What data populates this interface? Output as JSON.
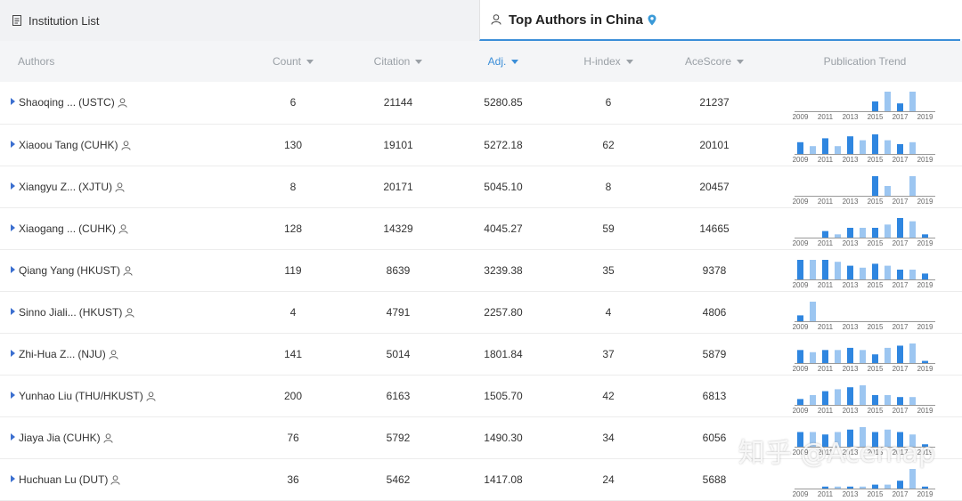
{
  "tabs": {
    "left_label": "Institution List",
    "right_label": "Top Authors in China"
  },
  "columns": {
    "authors": "Authors",
    "count": "Count",
    "citation": "Citation",
    "adj": "Adj.",
    "hindex": "H-index",
    "acescore": "AceScore",
    "trend": "Publication Trend"
  },
  "trend_year_labels": [
    "2009",
    "2011",
    "2013",
    "2015",
    "2017",
    "2019"
  ],
  "colors": {
    "bar_dark": "#2f86e0",
    "bar_light": "#9cc6f1",
    "accent": "#3b8ed8"
  },
  "rows": [
    {
      "name": "Shaoqing ...",
      "aff": "(USTC)",
      "count": "6",
      "citation": "21144",
      "adj": "5280.85",
      "hindex": "6",
      "acescore": "21237",
      "trend": [
        0,
        0,
        0,
        0,
        0,
        0,
        5,
        10,
        4,
        10,
        0
      ]
    },
    {
      "name": "Xiaoou Tang",
      "aff": "(CUHK)",
      "count": "130",
      "citation": "19101",
      "adj": "5272.18",
      "hindex": "62",
      "acescore": "20101",
      "trend": [
        6,
        4,
        8,
        4,
        9,
        7,
        10,
        7,
        5,
        6,
        0
      ]
    },
    {
      "name": "Xiangyu Z...",
      "aff": "(XJTU)",
      "count": "8",
      "citation": "20171",
      "adj": "5045.10",
      "hindex": "8",
      "acescore": "20457",
      "trend": [
        0,
        0,
        0,
        0,
        0,
        0,
        10,
        5,
        0,
        10,
        0
      ]
    },
    {
      "name": "Xiaogang ...",
      "aff": "(CUHK)",
      "count": "128",
      "citation": "14329",
      "adj": "4045.27",
      "hindex": "59",
      "acescore": "14665",
      "trend": [
        0,
        0,
        2,
        1,
        3,
        3,
        3,
        4,
        6,
        5,
        1
      ]
    },
    {
      "name": "Qiang Yang",
      "aff": "(HKUST)",
      "count": "119",
      "citation": "8639",
      "adj": "3239.38",
      "hindex": "35",
      "acescore": "9378",
      "trend": [
        10,
        10,
        10,
        9,
        7,
        6,
        8,
        7,
        5,
        5,
        3
      ]
    },
    {
      "name": "Sinno Jiali...",
      "aff": "(HKUST)",
      "count": "4",
      "citation": "4791",
      "adj": "2257.80",
      "hindex": "4",
      "acescore": "4806",
      "trend": [
        3,
        10,
        0,
        0,
        0,
        0,
        0,
        0,
        0,
        0,
        0
      ]
    },
    {
      "name": "Zhi-Hua Z...",
      "aff": "(NJU)",
      "count": "141",
      "citation": "5014",
      "adj": "1801.84",
      "hindex": "37",
      "acescore": "5879",
      "trend": [
        6,
        5,
        6,
        6,
        7,
        6,
        4,
        7,
        8,
        9,
        1
      ]
    },
    {
      "name": "Yunhao Liu",
      "aff": "(THU/HKUST)",
      "count": "200",
      "citation": "6163",
      "adj": "1505.70",
      "hindex": "42",
      "acescore": "6813",
      "trend": [
        3,
        5,
        7,
        8,
        9,
        10,
        5,
        5,
        4,
        4,
        0
      ]
    },
    {
      "name": "Jiaya Jia",
      "aff": "(CUHK)",
      "count": "76",
      "citation": "5792",
      "adj": "1490.30",
      "hindex": "34",
      "acescore": "6056",
      "trend": [
        6,
        6,
        5,
        6,
        7,
        8,
        6,
        7,
        6,
        5,
        1
      ]
    },
    {
      "name": "Huchuan Lu",
      "aff": "(DUT)",
      "count": "36",
      "citation": "5462",
      "adj": "1417.08",
      "hindex": "24",
      "acescore": "5688",
      "trend": [
        0,
        0,
        1,
        1,
        1,
        1,
        2,
        2,
        4,
        10,
        1
      ]
    }
  ],
  "watermark": "知乎 @Acemap"
}
